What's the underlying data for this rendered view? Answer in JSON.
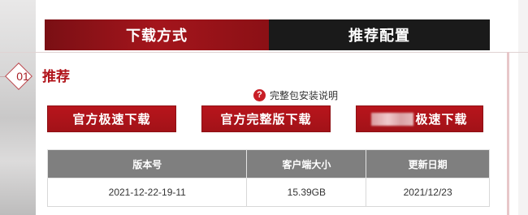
{
  "tabs": [
    {
      "label": "下载方式"
    },
    {
      "label": "推荐配置"
    }
  ],
  "section": {
    "number": "01",
    "title": "推荐"
  },
  "help": {
    "icon": "?",
    "label": "完整包安装说明"
  },
  "buttons": [
    {
      "label": "官方极速下载"
    },
    {
      "label": "官方完整版下载"
    },
    {
      "label": "极速下载"
    }
  ],
  "table": {
    "headers": [
      "版本号",
      "客户端大小",
      "更新日期"
    ],
    "rows": [
      [
        "2021-12-22-19-11",
        "15.39GB",
        "2021/12/23"
      ]
    ]
  },
  "colors": {
    "accent": "#b1141b",
    "tab_dark": "#1a1a1a",
    "header_gray": "#7f7f7f"
  }
}
